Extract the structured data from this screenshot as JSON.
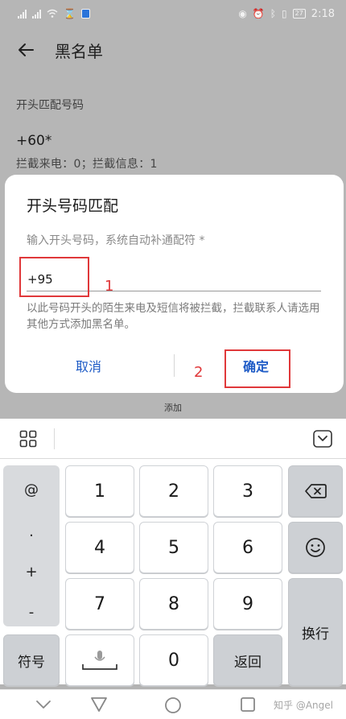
{
  "status_bar": {
    "left_icons": [
      "signal-icon",
      "signal-icon",
      "wifi-icon",
      "hourglass-icon",
      "shield-app-icon"
    ],
    "right_icons": [
      "eye-icon",
      "alarm-icon",
      "bluetooth-icon",
      "vibrate-icon"
    ],
    "battery": "27",
    "time": "2:18"
  },
  "app_bar": {
    "title": "黑名单"
  },
  "background_list": {
    "section_label": "开头匹配号码",
    "rule_title": "+60*",
    "rule_subtitle": "拦截来电：0；拦截信息：1",
    "add_label": "添加"
  },
  "dialog": {
    "title": "开头号码匹配",
    "hint": "输入开头号码，系统自动补通配符 *",
    "input_value": "+95",
    "description": "以此号码开头的陌生来电及短信将被拦截，拦截联系人请选用其他方式添加黑名单。",
    "cancel_label": "取消",
    "confirm_label": "确定"
  },
  "annotations": {
    "step1": "1",
    "step2": "2",
    "color": "#e0383a"
  },
  "keyboard": {
    "symbols": [
      "@",
      ".",
      "+",
      "-"
    ],
    "digits": [
      "1",
      "2",
      "3",
      "4",
      "5",
      "6",
      "7",
      "8",
      "9",
      "0"
    ],
    "symbol_key": "符号",
    "space_icon": "microphone-icon",
    "back_key": "返回",
    "enter_key": "换行"
  },
  "nav_bar": {
    "watermark": "知乎 @Angel"
  },
  "colors": {
    "accent": "#1e5bc6",
    "annotation": "#e0383a",
    "dim_background": "#b6b6b6"
  }
}
